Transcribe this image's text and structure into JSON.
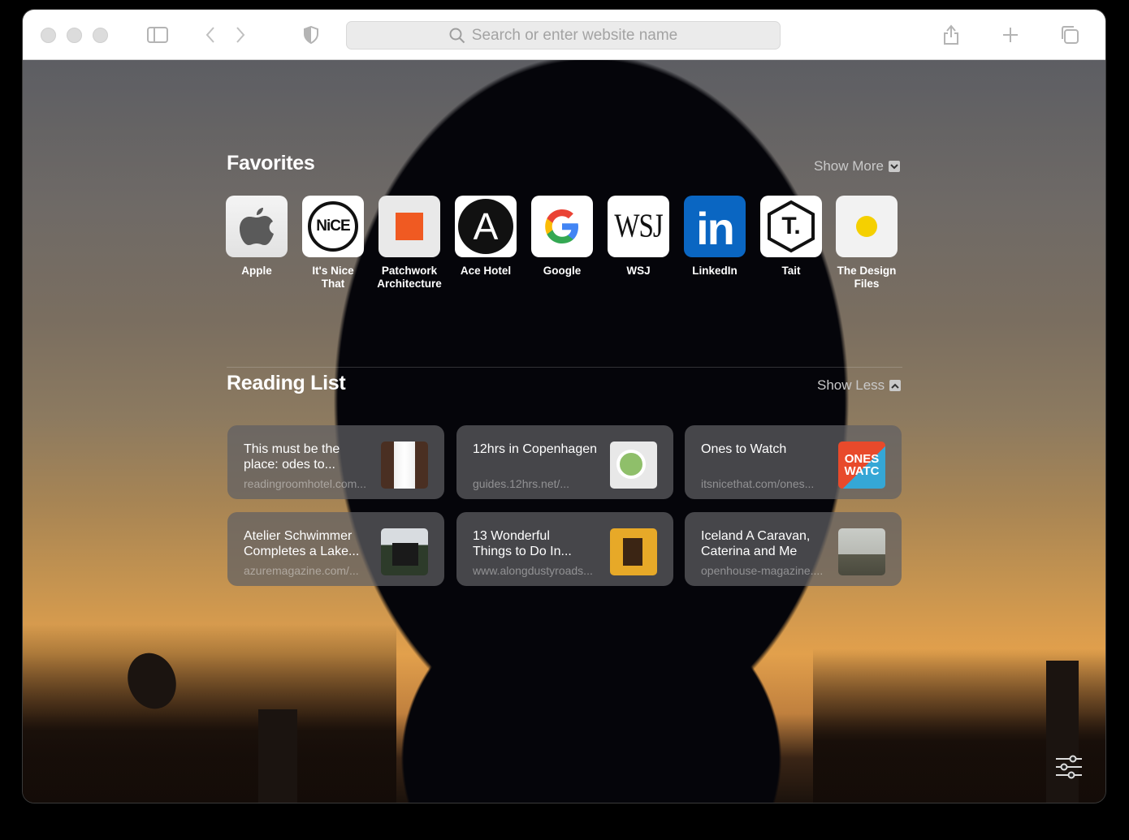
{
  "toolbar": {
    "search_placeholder": "Search or enter website name",
    "icons": [
      "sidebar-icon",
      "back-icon",
      "forward-icon",
      "privacy-shield-icon",
      "share-icon",
      "new-tab-icon",
      "tab-overview-icon"
    ]
  },
  "favorites": {
    "title": "Favorites",
    "toggle": "Show More",
    "items": [
      {
        "label": "Apple",
        "label2": ""
      },
      {
        "label": "It's Nice",
        "label2": "That"
      },
      {
        "label": "Patchwork",
        "label2": "Architecture"
      },
      {
        "label": "Ace Hotel",
        "label2": ""
      },
      {
        "label": "Google",
        "label2": ""
      },
      {
        "label": "WSJ",
        "label2": ""
      },
      {
        "label": "LinkedIn",
        "label2": ""
      },
      {
        "label": "Tait",
        "label2": ""
      },
      {
        "label": "The Design",
        "label2": "Files"
      }
    ],
    "tile_text": {
      "nice": "NiCE",
      "ace": "A",
      "google": "G",
      "wsj": "WSJ",
      "linkedin": "in",
      "tait": "T."
    }
  },
  "reading_list": {
    "title": "Reading List",
    "toggle": "Show Less",
    "items": [
      {
        "title1": "This must be the",
        "title2": "place: odes to...",
        "url": "readingroomhotel.com..."
      },
      {
        "title1": "12hrs in Copenhagen",
        "title2": "",
        "url": "guides.12hrs.net/..."
      },
      {
        "title1": "Ones to Watch",
        "title2": "",
        "url": "itsnicethat.com/ones..."
      },
      {
        "title1": "Atelier Schwimmer",
        "title2": "Completes a Lake...",
        "url": "azuremagazine.com/..."
      },
      {
        "title1": "13 Wonderful",
        "title2": "Things to Do In...",
        "url": "www.alongdustyroads..."
      },
      {
        "title1": "Iceland A Caravan,",
        "title2": "Caterina and Me",
        "url": "openhouse-magazine...."
      }
    ],
    "thumb_text": {
      "ones": "ONES WATC"
    }
  },
  "colors": {
    "linkedin": "#0a66c2",
    "patchwork": "#f05a22",
    "design_files": "#f5d000"
  }
}
